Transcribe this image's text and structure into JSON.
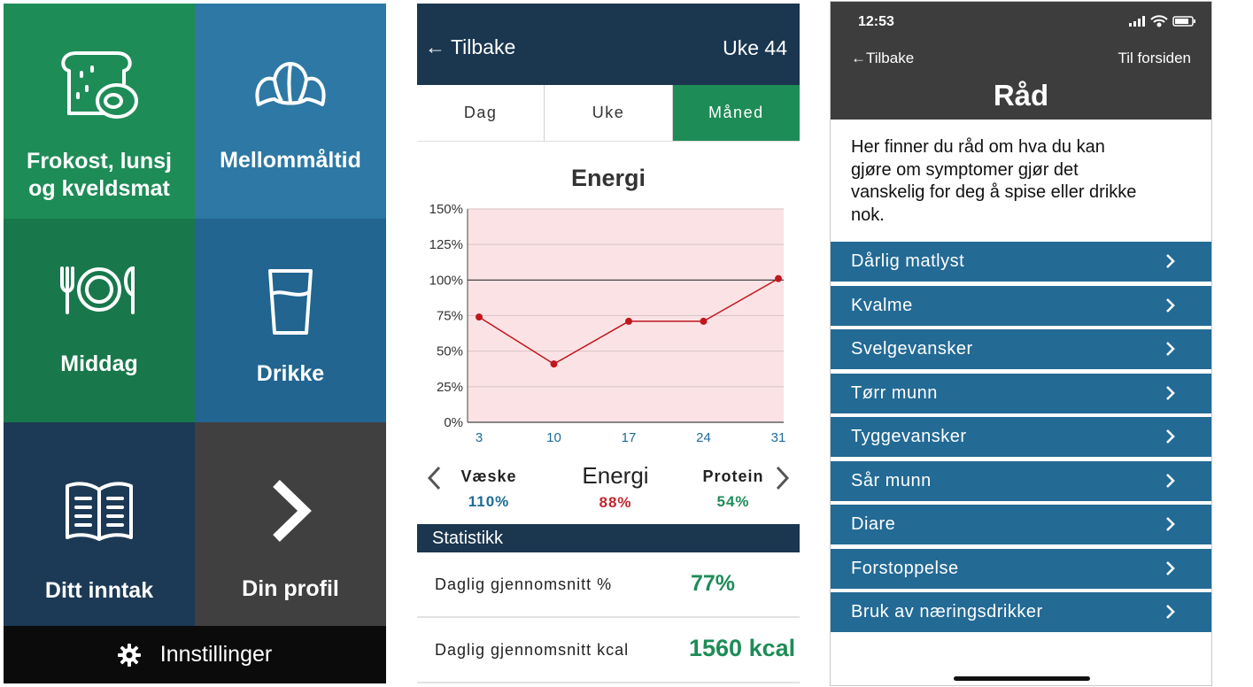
{
  "home": {
    "tiles": [
      {
        "label_line1": "Frokost, lunsj",
        "label_line2": "og kveldsmat",
        "icon": "bread-cheese-icon"
      },
      {
        "label": "Mellommåltid",
        "icon": "croissant-icon"
      },
      {
        "label": "Middag",
        "icon": "plate-cutlery-icon"
      },
      {
        "label": "Drikke",
        "icon": "glass-icon"
      },
      {
        "label": "Ditt inntak",
        "icon": "book-icon"
      },
      {
        "label": "Din profil",
        "icon": "chevron-right-icon"
      }
    ],
    "settings": {
      "label": "Innstillinger",
      "icon": "gear-icon"
    },
    "colors": {
      "green": "#1e8c57",
      "blue": "#2d78a4",
      "dark_green": "#18784b",
      "dark_blue": "#216590",
      "navy": "#1c3a55",
      "gray": "#404040"
    }
  },
  "energy_screen": {
    "back_label": "← Tilbake",
    "week_label": "Uke 44",
    "tabs": [
      "Dag",
      "Uke",
      "Måned"
    ],
    "active_tab": "Måned",
    "nutrients": [
      {
        "name": "Væske",
        "value": "110%",
        "color": "#1e6b95"
      },
      {
        "name": "Energi",
        "value": "88%",
        "color": "#c0272d"
      },
      {
        "name": "Protein",
        "value": "54%",
        "color": "#1e8c57"
      }
    ],
    "statistics_title": "Statistikk",
    "stats": [
      {
        "label": "Daglig gjennomsnitt %",
        "value": "77%"
      },
      {
        "label": "Daglig gjennomsnitt kcal",
        "value": "1560 kcal"
      }
    ]
  },
  "chart_data": {
    "type": "line",
    "title": "Energi",
    "x": [
      3,
      10,
      17,
      24,
      31
    ],
    "series": [
      {
        "values": [
          74,
          41,
          71,
          71,
          101
        ],
        "color": "#c0171d"
      }
    ],
    "y_ticks": [
      "0%",
      "25%",
      "50%",
      "75%",
      "100%",
      "125%",
      "150%"
    ],
    "x_ticks": [
      "3",
      "10",
      "17",
      "24",
      "31"
    ],
    "ylim": [
      0,
      150
    ],
    "reference_line": 100,
    "grid": true,
    "plot_background": "#fbe3e5"
  },
  "advice_screen": {
    "status_time": "12:53",
    "back_label": "←Tilbake",
    "home_label": "Til forsiden",
    "title": "Råd",
    "intro": "Her finner du råd om hva du kan gjøre om symptomer gjør det vanskelig for deg å spise eller drikke nok.",
    "intro_lines": [
      "Her finner du råd om hva du kan",
      "gjøre om symptomer gjør det",
      "vanskelig for deg å spise eller drikke",
      "nok."
    ],
    "items": [
      "Dårlig matlyst",
      "Kvalme",
      "Svelgevansker",
      "Tørr munn",
      "Tyggevansker",
      "Sår munn",
      "Diare",
      "Forstoppelse",
      "Bruk av næringsdrikker"
    ],
    "item_color": "#236a95"
  }
}
